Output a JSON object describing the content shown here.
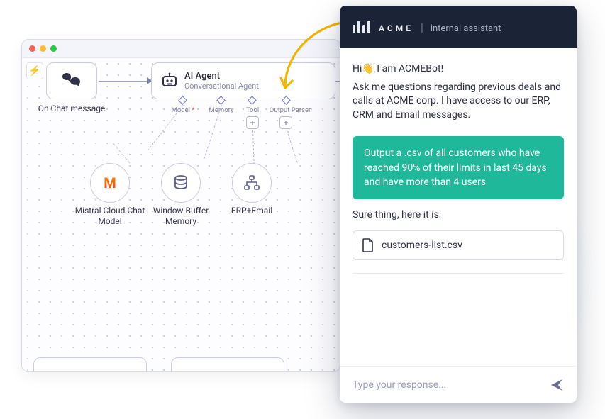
{
  "editor": {
    "trigger_label": "On Chat message",
    "agent": {
      "title": "AI Agent",
      "subtitle": "Conversational Agent"
    },
    "ports": {
      "model": "Model",
      "memory": "Memory",
      "tool": "Tool",
      "parser": "Output Parser"
    },
    "children": {
      "mistral": "Mistral Cloud Chat Model",
      "memory": "Window Buffer Memory",
      "erp": "ERP+Email"
    }
  },
  "chat": {
    "brand": "ACME",
    "brand_sub": "internal assistant",
    "greeting_line1": "Hi👋 I am ACMEBot!",
    "greeting_line2": "Ask me questions regarding previous deals and calls at ACME corp. I have access to our ERP, CRM and Email messages.",
    "user_msg": "Output a .csv of all customers who have reached 90% of their limits in last 45 days and have more than 4 users",
    "reply": "Sure thing, here it is:",
    "file_name": "customers-list.csv",
    "input_placeholder": "Type your response..."
  }
}
